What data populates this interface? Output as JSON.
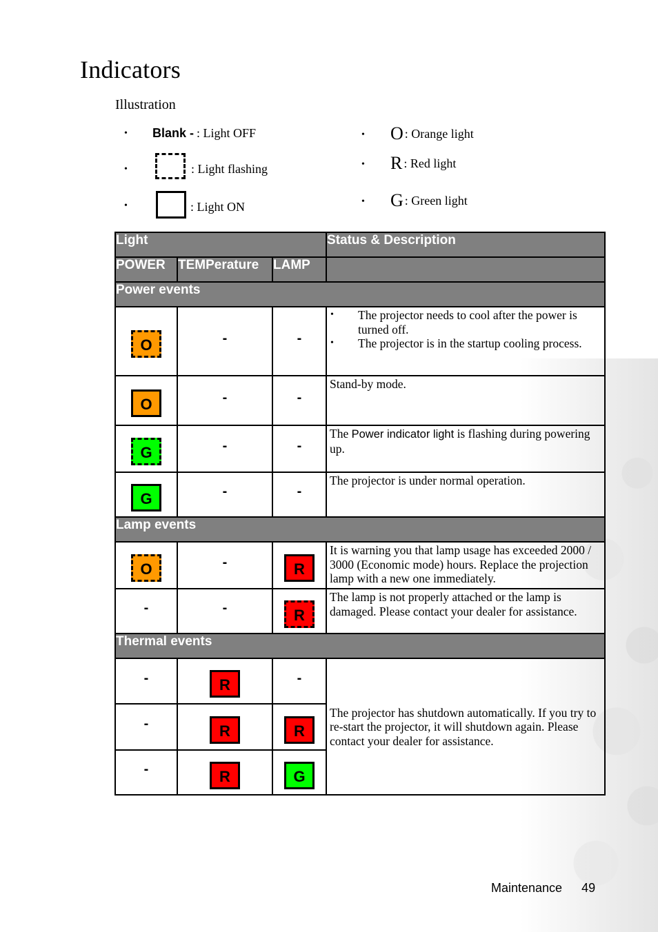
{
  "page": {
    "title": "Indicators",
    "subtitle": "Illustration",
    "footer": {
      "section": "Maintenance",
      "page_number": "49"
    }
  },
  "legend": {
    "left": [
      {
        "symbol": "Blank -",
        "label": ": Light OFF",
        "icon": "blank-dash-icon"
      },
      {
        "symbol": "",
        "label": ": Light flashing",
        "icon": "dashed-square-icon"
      },
      {
        "symbol": "",
        "label": ": Light ON",
        "icon": "solid-square-icon"
      }
    ],
    "right": [
      {
        "symbol": "O",
        "label": ": Orange light",
        "icon": "orange-letter-icon"
      },
      {
        "symbol": "R",
        "label": ": Red light",
        "icon": "red-letter-icon"
      },
      {
        "symbol": "G",
        "label": ": Green light",
        "icon": "green-letter-icon"
      }
    ]
  },
  "colors": {
    "header_gray": "#808080",
    "orange": "#FF9900",
    "red": "#FF0000",
    "green": "#00FF00"
  },
  "table": {
    "header": {
      "light": "Light",
      "status": "Status & Description",
      "columns": [
        "POWER",
        "TEMPerature",
        "LAMP"
      ]
    },
    "groups": [
      {
        "name": "Power events",
        "rows": [
          {
            "power": {
              "letter": "O",
              "color": "orange",
              "mode": "flash"
            },
            "temp": "-",
            "lamp": "-",
            "bullets": [
              "The projector needs to cool after the power is turned off.",
              "The projector is in the startup cooling process."
            ]
          },
          {
            "power": {
              "letter": "O",
              "color": "orange",
              "mode": "on"
            },
            "temp": "-",
            "lamp": "-",
            "description": "Stand-by mode."
          },
          {
            "power": {
              "letter": "G",
              "color": "green",
              "mode": "flash"
            },
            "temp": "-",
            "lamp": "-",
            "description_pre": "The ",
            "description_bold": "Power indicator light",
            "description_post": " is flashing during powering up."
          },
          {
            "power": {
              "letter": "G",
              "color": "green",
              "mode": "on"
            },
            "temp": "-",
            "lamp": "-",
            "description": "The projector is under normal operation."
          }
        ]
      },
      {
        "name": "Lamp events",
        "rows": [
          {
            "power": {
              "letter": "O",
              "color": "orange",
              "mode": "flash"
            },
            "temp": "-",
            "lamp": {
              "letter": "R",
              "color": "red",
              "mode": "on"
            },
            "description": "It is warning you that lamp usage has exceeded 2000 / 3000 (Economic mode) hours. Replace the projection lamp with a new one immediately."
          },
          {
            "power": "-",
            "temp": "-",
            "lamp": {
              "letter": "R",
              "color": "red",
              "mode": "flash"
            },
            "description": "The lamp is not properly attached or the lamp is damaged. Please contact your dealer for assistance."
          }
        ]
      },
      {
        "name": "Thermal events",
        "shared_description": "The projector has shutdown automatically. If you try to re-start the projector, it will shutdown again. Please contact your dealer for assistance.",
        "rows": [
          {
            "power": "-",
            "temp": {
              "letter": "R",
              "color": "red",
              "mode": "on"
            },
            "lamp": "-"
          },
          {
            "power": "-",
            "temp": {
              "letter": "R",
              "color": "red",
              "mode": "on"
            },
            "lamp": {
              "letter": "R",
              "color": "red",
              "mode": "on"
            }
          },
          {
            "power": "-",
            "temp": {
              "letter": "R",
              "color": "red",
              "mode": "on"
            },
            "lamp": {
              "letter": "G",
              "color": "green",
              "mode": "on"
            }
          }
        ]
      }
    ]
  }
}
